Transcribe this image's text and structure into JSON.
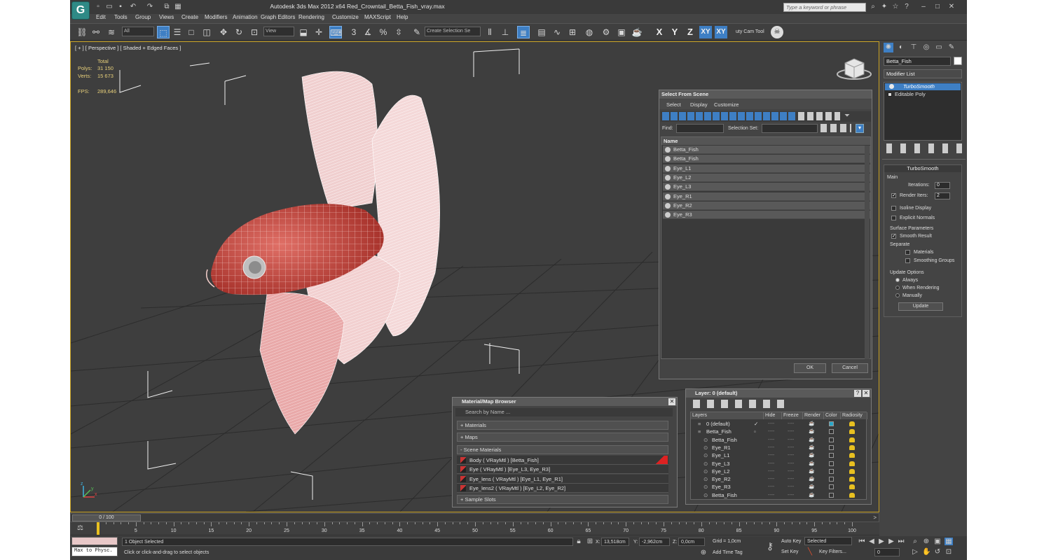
{
  "window": {
    "title": "Autodesk 3ds Max  2012 x64     Red_Crowntail_Betta_Fish_vray.max",
    "app_logo": "G",
    "search_placeholder": "Type a keyword or phrase"
  },
  "menu": [
    "Edit",
    "Tools",
    "Group",
    "Views",
    "Create",
    "Modifiers",
    "Animation",
    "Graph Editors",
    "Rendering",
    "Customize",
    "MAXScript",
    "Help"
  ],
  "toolbar": {
    "selection_filter": "All",
    "ref_coord": "View",
    "named_selection": "Create Selection Se",
    "axis_buttons": [
      "X",
      "Y",
      "Z",
      "XY",
      "XY"
    ],
    "camera_tool_label": "uty Cam Tool",
    "snap_labels": [
      "3",
      "%"
    ]
  },
  "viewport": {
    "label": "[ + ] [ Perspective ] [ Shaded + Edged Faces ]",
    "stats": {
      "total_label": "Total",
      "polys_label": "Polys:",
      "polys_value": "31 150",
      "verts_label": "Verts:",
      "verts_value": "15 673",
      "fps_label": "FPS:",
      "fps_value": "289,646"
    },
    "axis_labels": {
      "x": "x",
      "y": "y",
      "z": "z"
    }
  },
  "command_panel": {
    "object_name": "Betta_Fish",
    "modifier_list_label": "Modifier List",
    "stack": [
      "TurboSmooth",
      "Editable Poly"
    ],
    "turbosmooth": {
      "title": "TurboSmooth",
      "main_label": "Main",
      "iterations_label": "Iterations:",
      "iterations_value": "0",
      "render_iters_label": "Render Iters:",
      "render_iters_value": "2",
      "isoline_label": "Isoline Display",
      "explicit_normals_label": "Explicit Normals",
      "surface_params_label": "Surface Parameters",
      "smooth_result_label": "Smooth Result",
      "separate_label": "Separate",
      "materials_label": "Materials",
      "smoothing_groups_label": "Smoothing Groups",
      "update_options_label": "Update Options",
      "always_label": "Always",
      "when_rendering_label": "When Rendering",
      "manually_label": "Manually",
      "update_button": "Update"
    }
  },
  "select_from_scene": {
    "title": "Select From Scene",
    "menu": [
      "Select",
      "Display",
      "Customize"
    ],
    "find_label": "Find:",
    "selection_set_label": "Selection Set:",
    "column_name": "Name",
    "rows": [
      "Betta_Fish",
      "Betta_Fish",
      "Eye_L1",
      "Eye_L2",
      "Eye_L3",
      "Eye_R1",
      "Eye_R2",
      "Eye_R3"
    ],
    "ok_button": "OK",
    "cancel_button": "Cancel"
  },
  "material_browser": {
    "title": "Material/Map Browser",
    "search_placeholder": "Search by Name ...",
    "sections": {
      "materials": "+ Materials",
      "maps": "+ Maps",
      "scene": "- Scene Materials",
      "samples": "+ Sample Slots"
    },
    "scene_materials": [
      "Body  ( VRayMtl )  [Betta_Fish]",
      "Eye  ( VRayMtl )  [Eye_L3, Eye_R3]",
      "Eye_lens  ( VRayMtl )  [Eye_L1, Eye_R1]",
      "Eye_lens2  ( VRayMtl )  [Eye_L2, Eye_R2]"
    ]
  },
  "layer_manager": {
    "title": "Layer: 0 (default)",
    "help_button": "?",
    "columns": [
      "Layers",
      "Hide",
      "Freeze",
      "Render",
      "Color",
      "Radiosity"
    ],
    "rows": [
      {
        "name": "0 (default)",
        "indent": 0
      },
      {
        "name": "Betta_Fish",
        "indent": 0
      },
      {
        "name": "Betta_Fish",
        "indent": 1
      },
      {
        "name": "Eye_R1",
        "indent": 1
      },
      {
        "name": "Eye_L1",
        "indent": 1
      },
      {
        "name": "Eye_L3",
        "indent": 1
      },
      {
        "name": "Eye_L2",
        "indent": 1
      },
      {
        "name": "Eye_R2",
        "indent": 1
      },
      {
        "name": "Eye_R3",
        "indent": 1
      },
      {
        "name": "Betta_Fish",
        "indent": 1
      }
    ],
    "dash": "----"
  },
  "timeline": {
    "frame_counter": "0 / 100",
    "ticks": [
      0,
      5,
      10,
      15,
      20,
      25,
      30,
      35,
      40,
      45,
      50,
      55,
      60,
      65,
      70,
      75,
      80,
      85,
      90,
      95,
      100
    ]
  },
  "status": {
    "script_listener": "Max to Physc.",
    "selection_info": "1 Object Selected",
    "prompt": "Click or click-and-drag to select objects",
    "x_label": "X:",
    "x_value": "13,518cm",
    "y_label": "Y:",
    "y_value": "-2,962cm",
    "z_label": "Z:",
    "z_value": "0,0cm",
    "grid": "Grid = 1,0cm",
    "add_time_tag": "Add Time Tag",
    "auto_key": "Auto Key",
    "set_key": "Set Key",
    "key_mode": "Selected",
    "key_filters": "Key Filters...",
    "frame_value": "0"
  },
  "colors": {
    "accent": "#3e7fc4",
    "viewport_border": "#c8a020",
    "fish_body": "#c8473f",
    "fin": "#f2dede"
  }
}
